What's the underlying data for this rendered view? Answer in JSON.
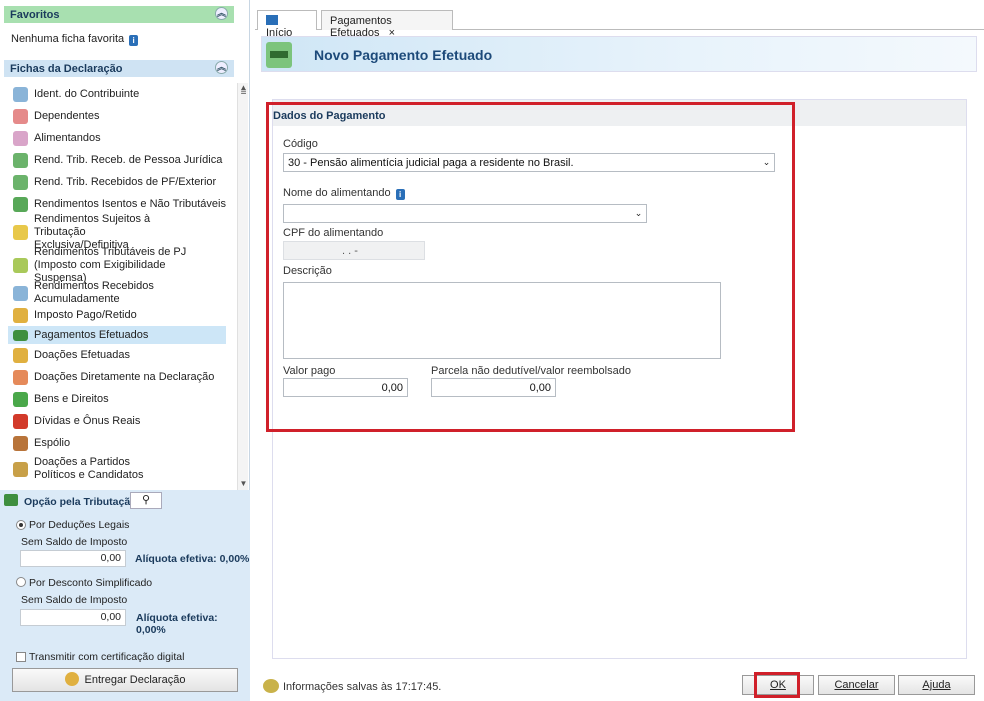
{
  "favorites": {
    "title": "Favoritos",
    "empty_text": "Nenhuma ficha favorita"
  },
  "fichas": {
    "title": "Fichas da Declaração",
    "items": [
      {
        "label": "Ident. do Contribuinte",
        "icon": "person-icon"
      },
      {
        "label": "Dependentes",
        "icon": "dependents-icon"
      },
      {
        "label": "Alimentandos",
        "icon": "alimentandos-icon"
      },
      {
        "label": "Rend. Trib. Receb. de Pessoa Jurídica",
        "icon": "income-pj-icon"
      },
      {
        "label": "Rend. Trib. Recebidos de PF/Exterior",
        "icon": "income-pf-icon"
      },
      {
        "label": "Rendimentos Isentos e Não Tributáveis",
        "icon": "exempt-income-icon"
      },
      {
        "label": "Rendimentos Sujeitos à Tributação Exclusiva/Definitiva",
        "icon": "exclusive-tax-icon"
      },
      {
        "label": "Rendimentos Tributáveis de PJ (Imposto com Exigibilidade Suspensa)",
        "icon": "suspended-tax-icon"
      },
      {
        "label": "Rendimentos Recebidos Acumuladamente",
        "icon": "accumulated-income-icon"
      },
      {
        "label": "Imposto Pago/Retido",
        "icon": "tax-paid-icon"
      },
      {
        "label": "Pagamentos Efetuados",
        "icon": "payment-card-icon"
      },
      {
        "label": "Doações Efetuadas",
        "icon": "donations-icon"
      },
      {
        "label": "Doações Diretamente na Declaração",
        "icon": "direct-donations-icon"
      },
      {
        "label": "Bens e Direitos",
        "icon": "assets-icon"
      },
      {
        "label": "Dívidas e Ônus Reais",
        "icon": "debts-icon"
      },
      {
        "label": "Espólio",
        "icon": "estate-icon"
      },
      {
        "label": "Doações a Partidos Políticos e Candidatos",
        "icon": "political-donations-icon"
      }
    ]
  },
  "tributacao": {
    "title": "Opção pela Tributação:",
    "deducoes": {
      "label": "Por Deduções Legais",
      "sub": "Sem Saldo de Imposto",
      "value": "0,00",
      "aliquota": "Alíquota efetiva: 0,00%"
    },
    "simplificado": {
      "label": "Por Desconto Simplificado",
      "sub": "Sem Saldo de Imposto",
      "value": "0,00",
      "aliquota": "Alíquota efetiva: 0,00%"
    },
    "transmitir": "Transmitir com certificação digital",
    "entregar": "Entregar Declaração"
  },
  "tabs": [
    {
      "label": "Início"
    },
    {
      "label": "Pagamentos Efetuados",
      "close": "×"
    }
  ],
  "banner": {
    "title": "Novo Pagamento Efetuado"
  },
  "form": {
    "section_title": "Dados do Pagamento",
    "codigo_label": "Código",
    "codigo_value": "30 - Pensão alimentícia judicial paga a residente no Brasil.",
    "nome_label": "Nome do alimentando",
    "nome_value": "",
    "cpf_label": "CPF do alimentando",
    "cpf_value": ". . -",
    "descricao_label": "Descrição",
    "valor_label": "Valor pago",
    "valor_value": "0,00",
    "parcela_label": "Parcela não dedutível/valor reembolsado",
    "parcela_value": "0,00"
  },
  "status": {
    "text": "Informações salvas às 17:17:45."
  },
  "buttons": {
    "ok": "OK",
    "cancelar": "Cancelar",
    "ajuda": "Ajuda"
  },
  "colors": {
    "highlight": "#d0202a",
    "accent": "#1d4a7a"
  }
}
